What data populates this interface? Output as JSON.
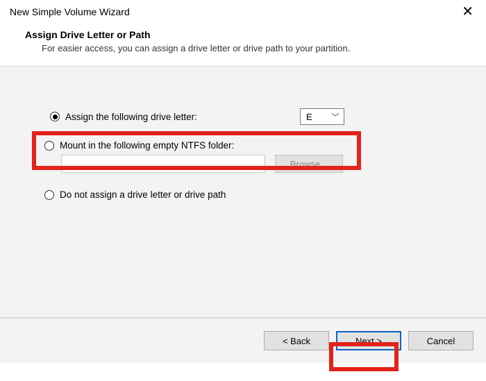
{
  "window": {
    "title": "New Simple Volume Wizard"
  },
  "header": {
    "step_title": "Assign Drive Letter or Path",
    "step_desc": "For easier access, you can assign a drive letter or drive path to your partition."
  },
  "options": {
    "assign_letter": {
      "label": "Assign the following drive letter:",
      "selected_value": "E",
      "checked": true
    },
    "mount_folder": {
      "label": "Mount in the following empty NTFS folder:",
      "value": "",
      "browse_label": "Browse...",
      "checked": false
    },
    "no_assign": {
      "label": "Do not assign a drive letter or drive path",
      "checked": false
    }
  },
  "footer": {
    "back": "< Back",
    "next": "Next >",
    "cancel": "Cancel"
  }
}
